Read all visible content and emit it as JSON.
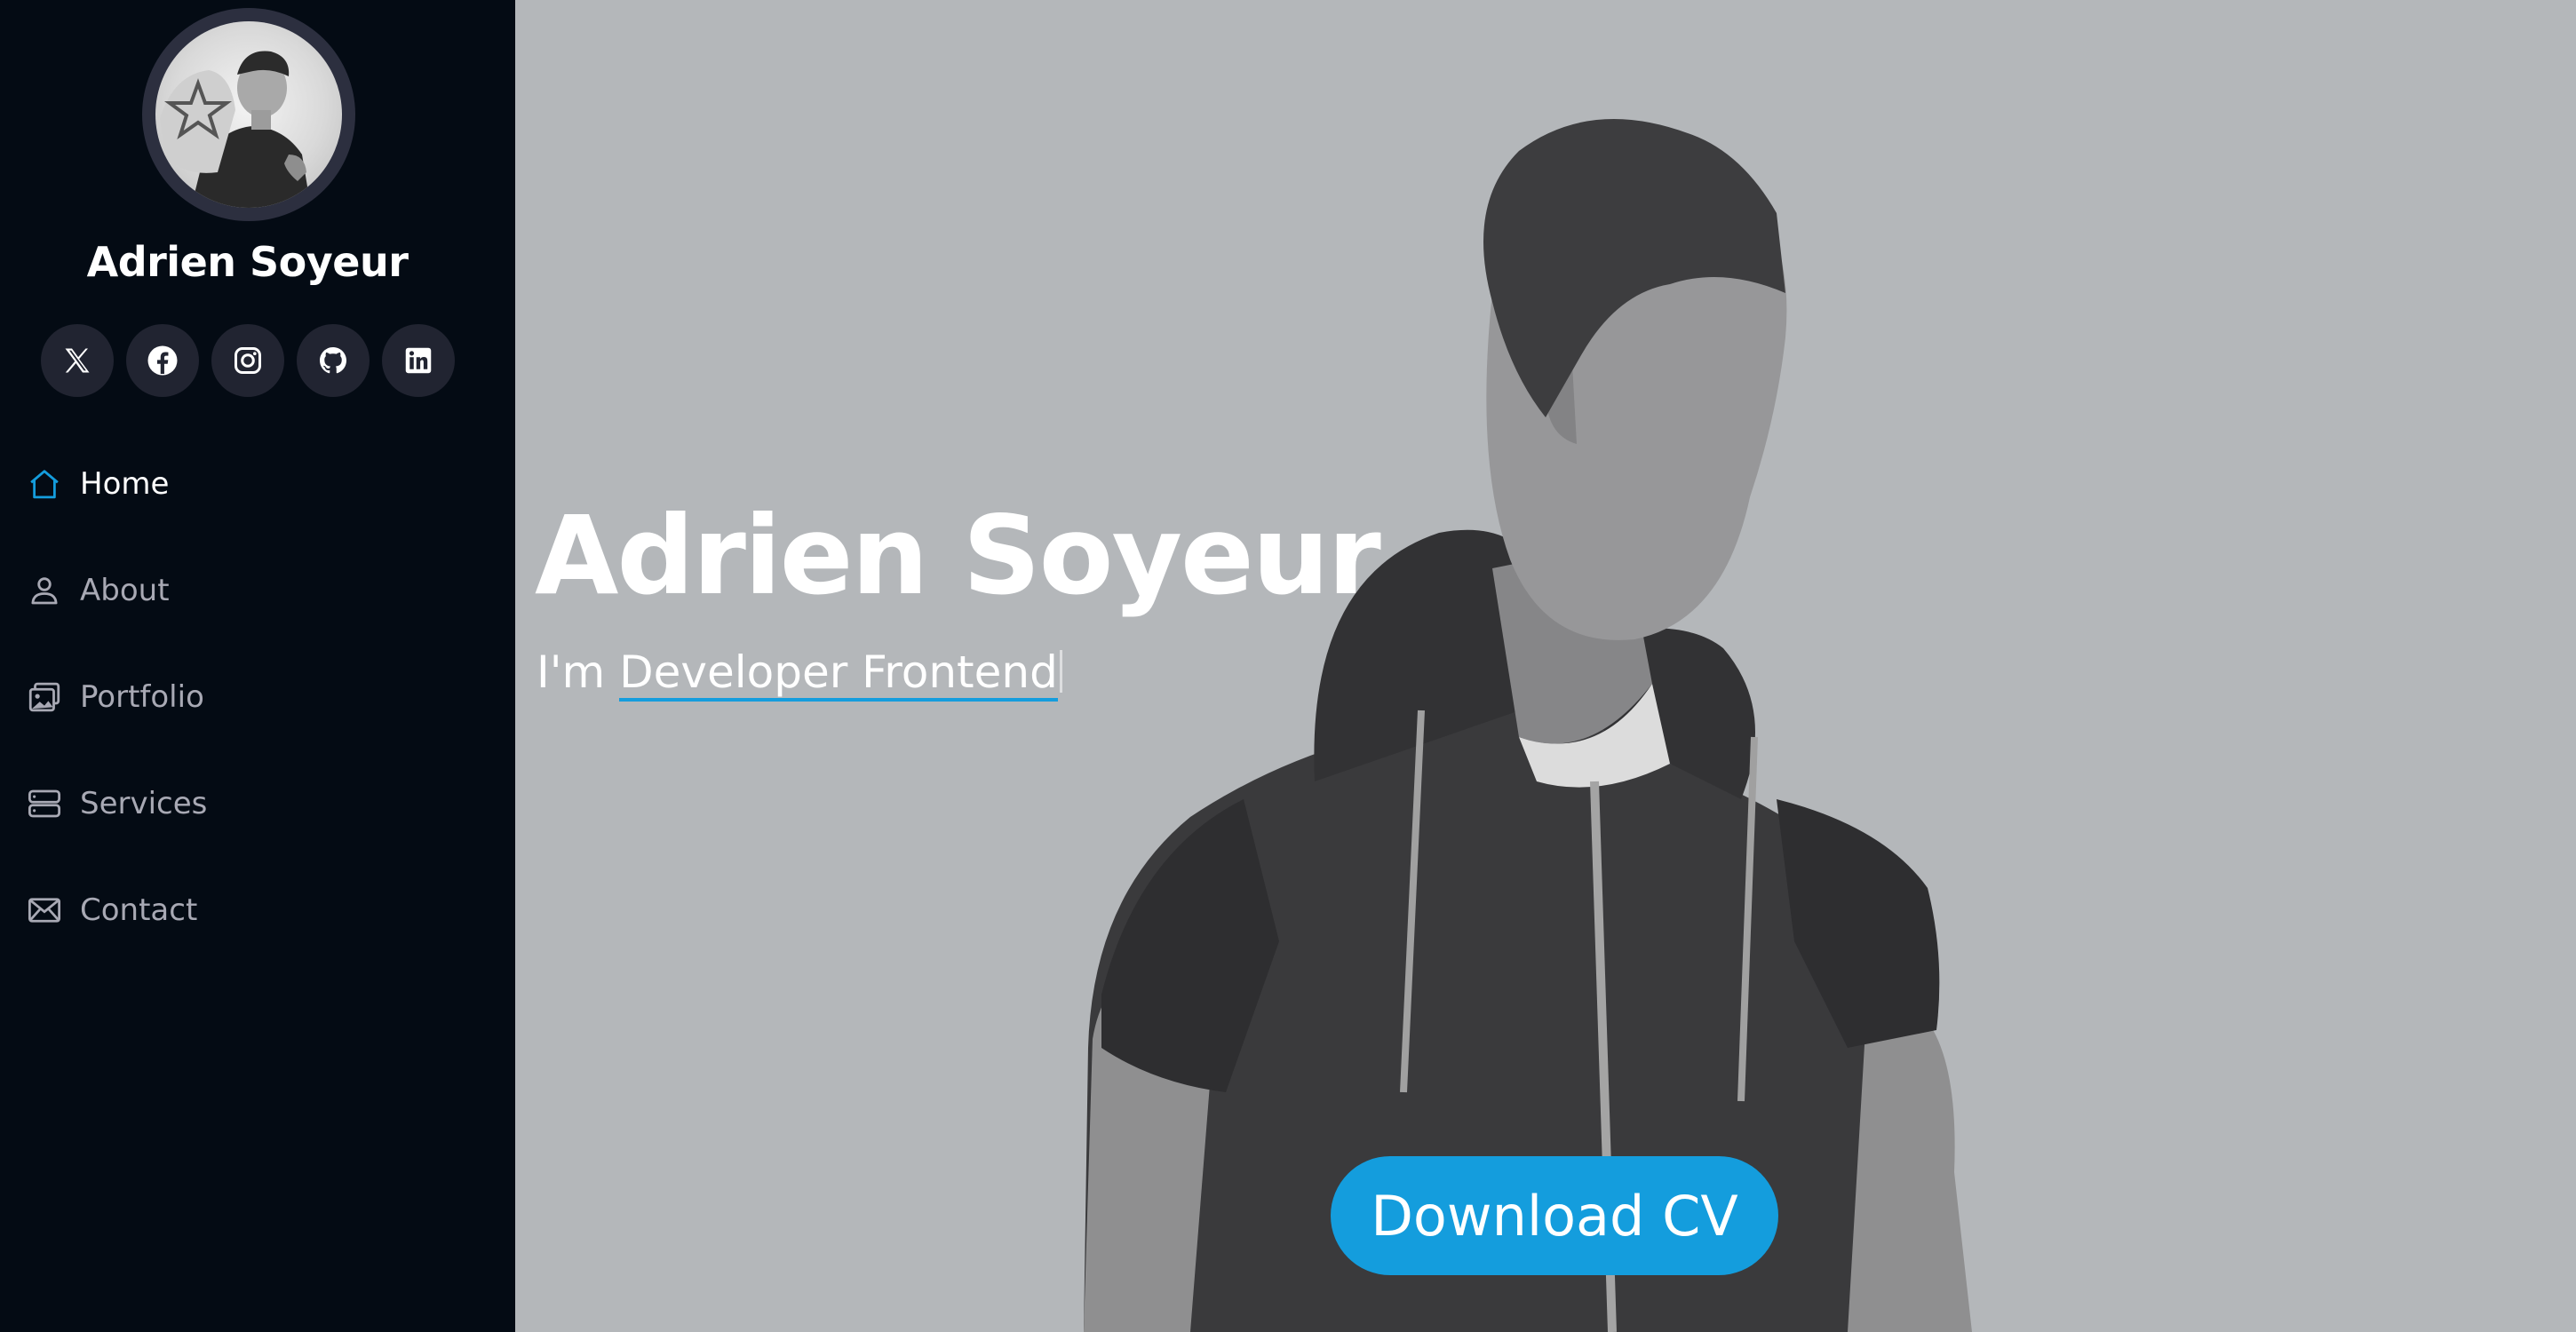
{
  "profile": {
    "name": "Adrien Soyeur"
  },
  "social": [
    {
      "name": "x",
      "icon": "x-icon"
    },
    {
      "name": "facebook",
      "icon": "facebook-icon"
    },
    {
      "name": "instagram",
      "icon": "instagram-icon"
    },
    {
      "name": "github",
      "icon": "github-icon"
    },
    {
      "name": "linkedin",
      "icon": "linkedin-icon"
    }
  ],
  "nav": {
    "items": [
      {
        "label": "Home",
        "icon": "home-icon",
        "active": true
      },
      {
        "label": "About",
        "icon": "person-icon",
        "active": false
      },
      {
        "label": "Portfolio",
        "icon": "images-icon",
        "active": false
      },
      {
        "label": "Services",
        "icon": "server-icon",
        "active": false
      },
      {
        "label": "Contact",
        "icon": "envelope-icon",
        "active": false
      }
    ]
  },
  "hero": {
    "title": "Adrien Soyeur",
    "prefix": "I'm",
    "typed": "Developer Frontend",
    "cta": "Download CV"
  },
  "colors": {
    "sidebar_bg": "#040b14",
    "accent": "#149ddd",
    "hero_bg": "#b4b7ba",
    "social_bg": "#212431",
    "nav_text": "#a8a9b4"
  }
}
